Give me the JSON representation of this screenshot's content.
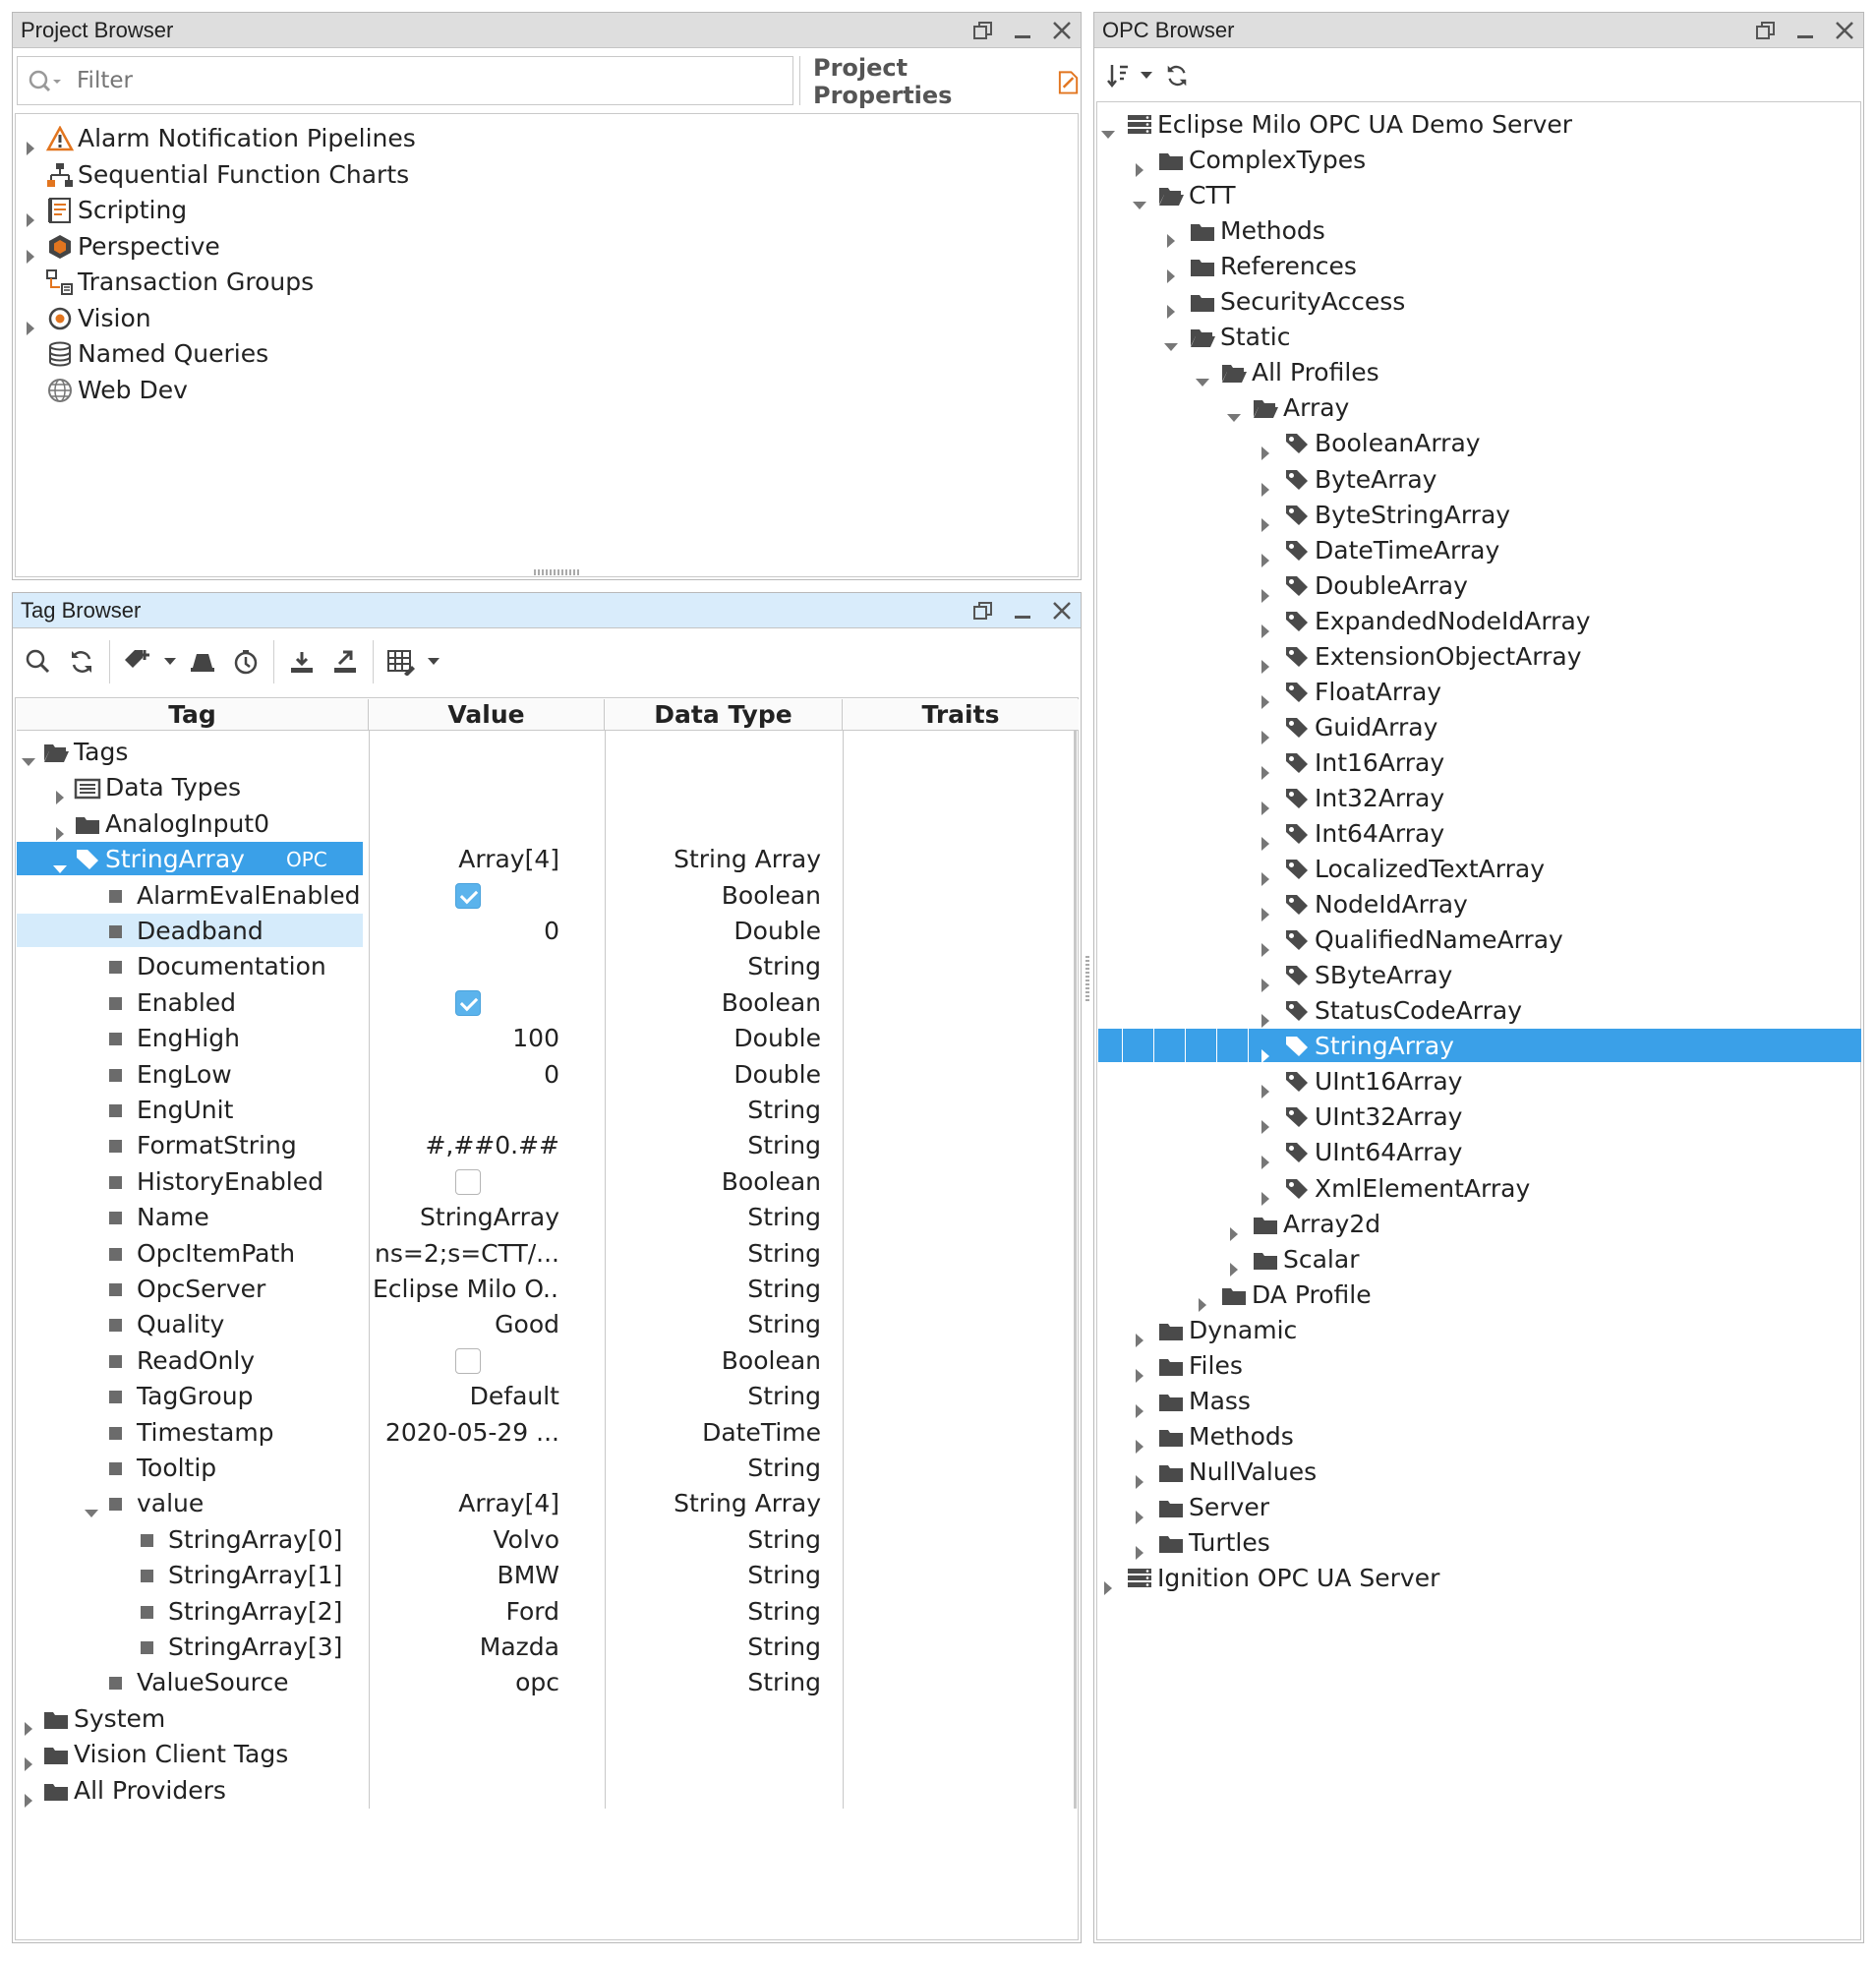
{
  "colors": {
    "selection": "#3aa0e8",
    "selection_light": "#d5ebfb",
    "titlebar": "#dedede",
    "titlebar_active": "#d9ecfb"
  },
  "project_browser": {
    "title": "Project Browser",
    "filter_placeholder": "Filter",
    "properties_label": "Project Properties",
    "items": [
      {
        "label": "Alarm Notification Pipelines",
        "icon": "alarm-pipeline-icon",
        "expandable": true
      },
      {
        "label": "Sequential Function Charts",
        "icon": "sfc-icon",
        "expandable": false
      },
      {
        "label": "Scripting",
        "icon": "scripting-icon",
        "expandable": true
      },
      {
        "label": "Perspective",
        "icon": "perspective-icon",
        "expandable": true
      },
      {
        "label": "Transaction Groups",
        "icon": "transaction-groups-icon",
        "expandable": false
      },
      {
        "label": "Vision",
        "icon": "vision-icon",
        "expandable": true
      },
      {
        "label": "Named Queries",
        "icon": "named-queries-icon",
        "expandable": false
      },
      {
        "label": "Web Dev",
        "icon": "web-dev-icon",
        "expandable": false
      }
    ]
  },
  "tag_browser": {
    "title": "Tag Browser",
    "columns": [
      "Tag",
      "Value",
      "Data Type",
      "Traits"
    ],
    "selected_tag_badge": "OPC",
    "rows": [
      {
        "tag": "Tags",
        "value": "",
        "type": "",
        "depth": 0,
        "icon": "folder-open",
        "exp": "open"
      },
      {
        "tag": "Data Types",
        "value": "",
        "type": "",
        "depth": 1,
        "icon": "udt-folder",
        "exp": "closed"
      },
      {
        "tag": "AnalogInput0",
        "value": "",
        "type": "",
        "depth": 1,
        "icon": "folder",
        "exp": "closed"
      },
      {
        "tag": "StringArray",
        "value": "Array[4]",
        "type": "String Array",
        "depth": 1,
        "icon": "tag",
        "exp": "open",
        "sel": "strong"
      },
      {
        "tag": "AlarmEvalEnabled",
        "value": "",
        "type": "Boolean",
        "depth": 2,
        "icon": "prop",
        "check": "on"
      },
      {
        "tag": "Deadband",
        "value": "0",
        "type": "Double",
        "depth": 2,
        "icon": "prop",
        "sel": "light"
      },
      {
        "tag": "Documentation",
        "value": "",
        "type": "String",
        "depth": 2,
        "icon": "prop"
      },
      {
        "tag": "Enabled",
        "value": "",
        "type": "Boolean",
        "depth": 2,
        "icon": "prop",
        "check": "on"
      },
      {
        "tag": "EngHigh",
        "value": "100",
        "type": "Double",
        "depth": 2,
        "icon": "prop"
      },
      {
        "tag": "EngLow",
        "value": "0",
        "type": "Double",
        "depth": 2,
        "icon": "prop"
      },
      {
        "tag": "EngUnit",
        "value": "",
        "type": "String",
        "depth": 2,
        "icon": "prop"
      },
      {
        "tag": "FormatString",
        "value": "#,##0.##",
        "type": "String",
        "depth": 2,
        "icon": "prop"
      },
      {
        "tag": "HistoryEnabled",
        "value": "",
        "type": "Boolean",
        "depth": 2,
        "icon": "prop",
        "check": "off"
      },
      {
        "tag": "Name",
        "value": "StringArray",
        "type": "String",
        "depth": 2,
        "icon": "prop"
      },
      {
        "tag": "OpcItemPath",
        "value": "ns=2;s=CTT/...",
        "type": "String",
        "depth": 2,
        "icon": "prop"
      },
      {
        "tag": "OpcServer",
        "value": "Eclipse Milo O...",
        "type": "String",
        "depth": 2,
        "icon": "prop"
      },
      {
        "tag": "Quality",
        "value": "Good",
        "type": "String",
        "depth": 2,
        "icon": "prop"
      },
      {
        "tag": "ReadOnly",
        "value": "",
        "type": "Boolean",
        "depth": 2,
        "icon": "prop",
        "check": "off"
      },
      {
        "tag": "TagGroup",
        "value": "Default",
        "type": "String",
        "depth": 2,
        "icon": "prop"
      },
      {
        "tag": "Timestamp",
        "value": "2020-05-29 ...",
        "type": "DateTime",
        "depth": 2,
        "icon": "prop"
      },
      {
        "tag": "Tooltip",
        "value": "",
        "type": "String",
        "depth": 2,
        "icon": "prop"
      },
      {
        "tag": "value",
        "value": "Array[4]",
        "type": "String Array",
        "depth": 2,
        "icon": "prop",
        "exp": "open"
      },
      {
        "tag": "StringArray[0]",
        "value": "Volvo",
        "type": "String",
        "depth": 3,
        "icon": "prop"
      },
      {
        "tag": "StringArray[1]",
        "value": "BMW",
        "type": "String",
        "depth": 3,
        "icon": "prop"
      },
      {
        "tag": "StringArray[2]",
        "value": "Ford",
        "type": "String",
        "depth": 3,
        "icon": "prop"
      },
      {
        "tag": "StringArray[3]",
        "value": "Mazda",
        "type": "String",
        "depth": 3,
        "icon": "prop"
      },
      {
        "tag": "ValueSource",
        "value": "opc",
        "type": "String",
        "depth": 2,
        "icon": "prop"
      },
      {
        "tag": "System",
        "value": "",
        "type": "",
        "depth": 0,
        "icon": "folder",
        "exp": "closed"
      },
      {
        "tag": "Vision Client Tags",
        "value": "",
        "type": "",
        "depth": 0,
        "icon": "folder",
        "exp": "closed"
      },
      {
        "tag": "All Providers",
        "value": "",
        "type": "",
        "depth": 0,
        "icon": "folder",
        "exp": "closed"
      }
    ]
  },
  "opc_browser": {
    "title": "OPC Browser",
    "nodes": [
      {
        "label": "Eclipse Milo OPC UA Demo Server",
        "depth": 0,
        "icon": "server",
        "exp": "open"
      },
      {
        "label": "ComplexTypes",
        "depth": 1,
        "icon": "folder",
        "exp": "closed"
      },
      {
        "label": "CTT",
        "depth": 1,
        "icon": "folder-open",
        "exp": "open"
      },
      {
        "label": "Methods",
        "depth": 2,
        "icon": "folder",
        "exp": "closed"
      },
      {
        "label": "References",
        "depth": 2,
        "icon": "folder",
        "exp": "closed"
      },
      {
        "label": "SecurityAccess",
        "depth": 2,
        "icon": "folder",
        "exp": "closed"
      },
      {
        "label": "Static",
        "depth": 2,
        "icon": "folder-open",
        "exp": "open"
      },
      {
        "label": "All Profiles",
        "depth": 3,
        "icon": "folder-open",
        "exp": "open"
      },
      {
        "label": "Array",
        "depth": 4,
        "icon": "folder-open",
        "exp": "open"
      },
      {
        "label": "BooleanArray",
        "depth": 5,
        "icon": "tag",
        "exp": "closed"
      },
      {
        "label": "ByteArray",
        "depth": 5,
        "icon": "tag",
        "exp": "closed"
      },
      {
        "label": "ByteStringArray",
        "depth": 5,
        "icon": "tag",
        "exp": "closed"
      },
      {
        "label": "DateTimeArray",
        "depth": 5,
        "icon": "tag",
        "exp": "closed"
      },
      {
        "label": "DoubleArray",
        "depth": 5,
        "icon": "tag",
        "exp": "closed"
      },
      {
        "label": "ExpandedNodeIdArray",
        "depth": 5,
        "icon": "tag",
        "exp": "closed"
      },
      {
        "label": "ExtensionObjectArray",
        "depth": 5,
        "icon": "tag",
        "exp": "closed"
      },
      {
        "label": "FloatArray",
        "depth": 5,
        "icon": "tag",
        "exp": "closed"
      },
      {
        "label": "GuidArray",
        "depth": 5,
        "icon": "tag",
        "exp": "closed"
      },
      {
        "label": "Int16Array",
        "depth": 5,
        "icon": "tag",
        "exp": "closed"
      },
      {
        "label": "Int32Array",
        "depth": 5,
        "icon": "tag",
        "exp": "closed"
      },
      {
        "label": "Int64Array",
        "depth": 5,
        "icon": "tag",
        "exp": "closed"
      },
      {
        "label": "LocalizedTextArray",
        "depth": 5,
        "icon": "tag",
        "exp": "closed"
      },
      {
        "label": "NodeIdArray",
        "depth": 5,
        "icon": "tag",
        "exp": "closed"
      },
      {
        "label": "QualifiedNameArray",
        "depth": 5,
        "icon": "tag",
        "exp": "closed"
      },
      {
        "label": "SByteArray",
        "depth": 5,
        "icon": "tag",
        "exp": "closed"
      },
      {
        "label": "StatusCodeArray",
        "depth": 5,
        "icon": "tag",
        "exp": "closed"
      },
      {
        "label": "StringArray",
        "depth": 5,
        "icon": "tag",
        "exp": "closed",
        "sel": "strong"
      },
      {
        "label": "UInt16Array",
        "depth": 5,
        "icon": "tag",
        "exp": "closed"
      },
      {
        "label": "UInt32Array",
        "depth": 5,
        "icon": "tag",
        "exp": "closed"
      },
      {
        "label": "UInt64Array",
        "depth": 5,
        "icon": "tag",
        "exp": "closed"
      },
      {
        "label": "XmlElementArray",
        "depth": 5,
        "icon": "tag",
        "exp": "closed"
      },
      {
        "label": "Array2d",
        "depth": 4,
        "icon": "folder",
        "exp": "closed"
      },
      {
        "label": "Scalar",
        "depth": 4,
        "icon": "folder",
        "exp": "closed"
      },
      {
        "label": "DA Profile",
        "depth": 3,
        "icon": "folder",
        "exp": "closed"
      },
      {
        "label": "Dynamic",
        "depth": 1,
        "icon": "folder",
        "exp": "closed"
      },
      {
        "label": "Files",
        "depth": 1,
        "icon": "folder",
        "exp": "closed"
      },
      {
        "label": "Mass",
        "depth": 1,
        "icon": "folder",
        "exp": "closed"
      },
      {
        "label": "Methods",
        "depth": 1,
        "icon": "folder",
        "exp": "closed"
      },
      {
        "label": "NullValues",
        "depth": 1,
        "icon": "folder",
        "exp": "closed"
      },
      {
        "label": "Server",
        "depth": 1,
        "icon": "folder",
        "exp": "closed"
      },
      {
        "label": "Turtles",
        "depth": 1,
        "icon": "folder",
        "exp": "closed"
      },
      {
        "label": "Ignition OPC UA Server",
        "depth": 0,
        "icon": "server",
        "exp": "closed"
      }
    ]
  }
}
